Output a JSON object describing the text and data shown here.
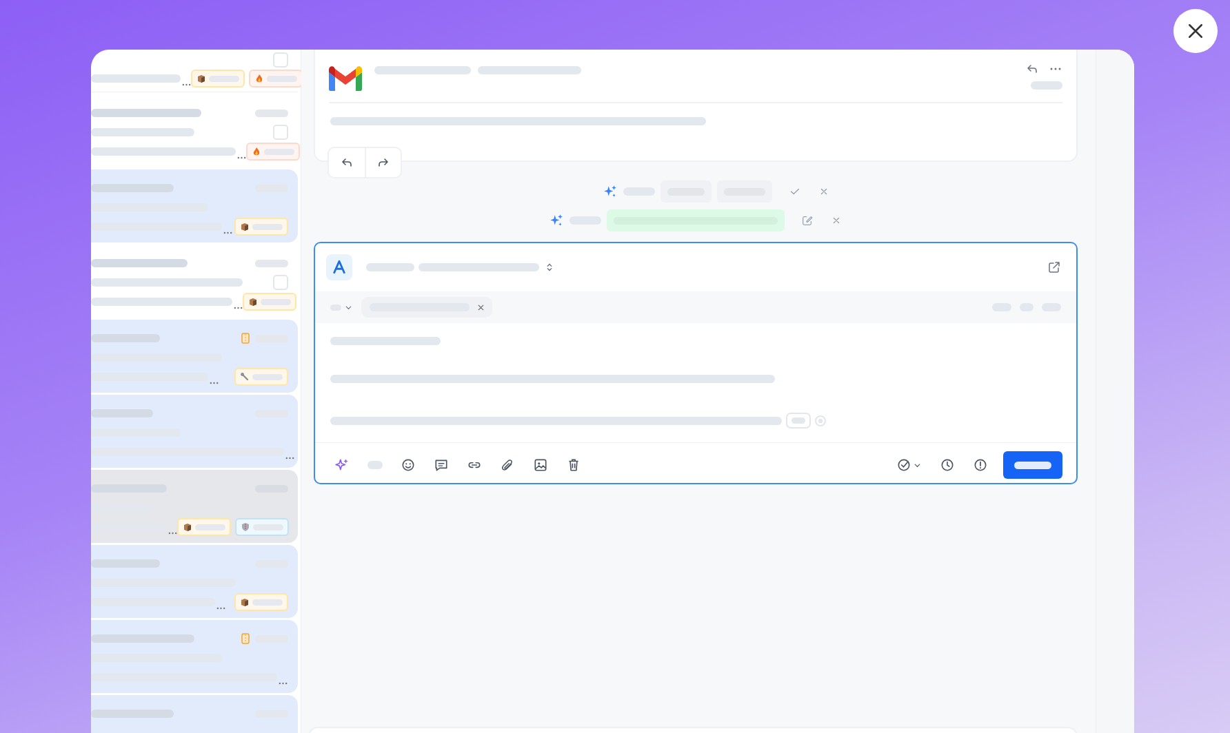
{
  "conversations": [
    {
      "unread": false,
      "selected": false,
      "attachment": true,
      "tags": [
        {
          "kind": "package"
        },
        {
          "kind": "fire"
        }
      ]
    },
    {
      "unread": false,
      "selected": false,
      "flag": false,
      "attachment": true,
      "tags": [
        {
          "kind": "fire"
        }
      ]
    },
    {
      "unread": true,
      "selected": false,
      "flag": false,
      "attachment": false,
      "tags": [
        {
          "kind": "package"
        }
      ]
    },
    {
      "unread": false,
      "selected": false,
      "flag": false,
      "attachment": true,
      "tags": [
        {
          "kind": "package"
        }
      ]
    },
    {
      "unread": true,
      "selected": false,
      "flag": true,
      "attachment": false,
      "tags": [
        {
          "kind": "wrench"
        }
      ]
    },
    {
      "unread": true,
      "selected": false,
      "flag": false,
      "attachment": false
    },
    {
      "selected": true,
      "flag": false,
      "attachment": false,
      "tags": [
        {
          "kind": "package"
        },
        {
          "kind": "shield"
        }
      ]
    },
    {
      "unread": true,
      "selected": false,
      "flag": false,
      "attachment": false,
      "tags": [
        {
          "kind": "package"
        }
      ]
    },
    {
      "unread": true,
      "selected": false,
      "flag": true,
      "attachment": false
    },
    {
      "unread": true,
      "selected": false,
      "flag": false
    }
  ],
  "suggestions": [
    {
      "kind": "choices"
    },
    {
      "kind": "accepted"
    }
  ]
}
